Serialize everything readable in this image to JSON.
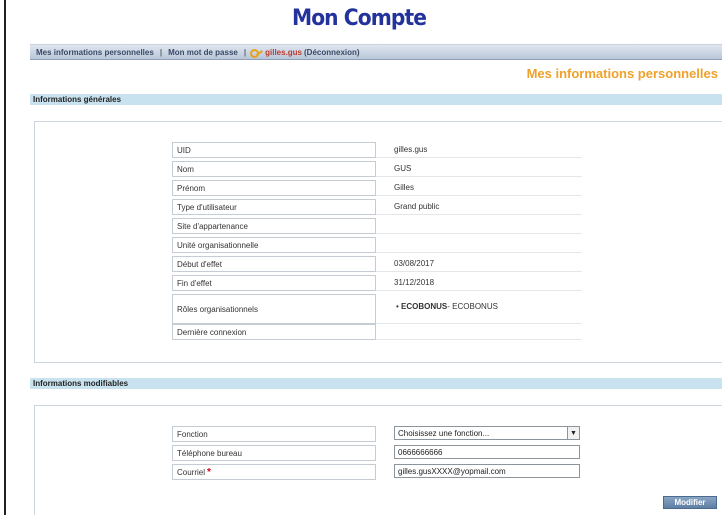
{
  "header": {
    "title": "Mon Compte"
  },
  "nav": {
    "items": [
      "Mes informations personnelles",
      "Mon mot de passe"
    ],
    "user": "gilles.gus",
    "logout": "(Déconnexion)"
  },
  "page": {
    "subtitle": "Mes informations personnelles"
  },
  "general": {
    "title": "Informations générales",
    "rows": [
      {
        "label": "UID",
        "value": "gilles.gus"
      },
      {
        "label": "Nom",
        "value": "GUS"
      },
      {
        "label": "Prénom",
        "value": "Gilles"
      },
      {
        "label": "Type d'utilisateur",
        "value": "Grand public"
      },
      {
        "label": "Site d'appartenance",
        "value": ""
      },
      {
        "label": "Unité organisationnelle",
        "value": ""
      },
      {
        "label": "Début d'effet",
        "value": "03/08/2017"
      },
      {
        "label": "Fin d'effet",
        "value": "31/12/2018"
      },
      {
        "label": "Rôles organisationnels",
        "role_bold": "ECOBONUS",
        "role_rest": " - ECOBONUS"
      },
      {
        "label": "Dernière connexion",
        "value": ""
      }
    ]
  },
  "editable": {
    "title": "Informations modifiables",
    "fonction": {
      "label": "Fonction",
      "value": "Choisissez une fonction..."
    },
    "telephone": {
      "label": "Téléphone bureau",
      "value": "0666666666"
    },
    "courriel": {
      "label": "Courriel",
      "required_mark": "*",
      "value": "gilles.gusXXXX@yopmail.com"
    }
  },
  "actions": {
    "modify_label": "Modifier"
  }
}
